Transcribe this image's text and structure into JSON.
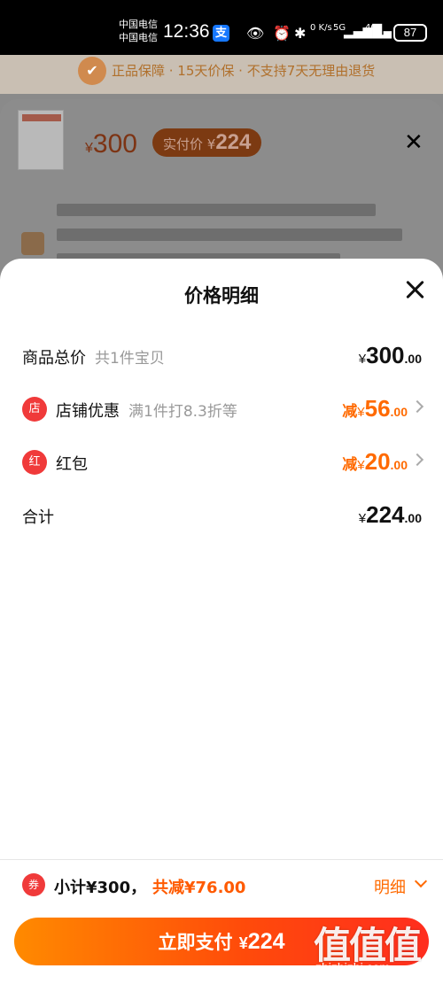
{
  "status_bar": {
    "carrier_1": "中国电信",
    "carrier_2": "中国电信",
    "time": "12:36",
    "alipay_icon_glyph": "支",
    "network_speed": "0 K/s",
    "signal_1": "5G",
    "signal_2": "4G",
    "battery": "87"
  },
  "background_page": {
    "guarantee_text": "正品保障 · 15天价保 · 不支持7天无理由退货",
    "price_currency": "¥",
    "price": "300",
    "paid_label": "实付价 ¥",
    "paid_value": "224"
  },
  "sheet": {
    "title": "价格明细",
    "rows": [
      {
        "label": "商品总价",
        "sub": "共1件宝贝",
        "currency": "¥",
        "int": "300",
        "dec": ".00"
      },
      {
        "icon": "store",
        "icon_glyph": "店",
        "label": "店铺优惠",
        "sub": "满1件打8.3折等",
        "prefix": "减",
        "currency": "¥",
        "int": "56",
        "dec": ".00"
      },
      {
        "icon": "red-packet",
        "icon_glyph": "红",
        "label": "红包",
        "prefix": "减",
        "currency": "¥",
        "int": "20",
        "dec": ".00"
      },
      {
        "label": "合计",
        "currency": "¥",
        "int": "224",
        "dec": ".00"
      }
    ]
  },
  "footer": {
    "coupon_icon_glyph": "券",
    "subtotal": "小计¥300，",
    "saved": "共减¥76.00",
    "detail_link": "明细",
    "pay_label": "立即支付",
    "pay_currency": "¥",
    "pay_value": "224"
  },
  "watermark": {
    "chars": "值值值",
    "url": "zhizhizhi.com"
  },
  "colors": {
    "accent_orange": "#ff6a00",
    "icon_red": "#f03a3a",
    "pay_gradient_start": "#ff8a00",
    "pay_gradient_end": "#ff2d1e"
  }
}
